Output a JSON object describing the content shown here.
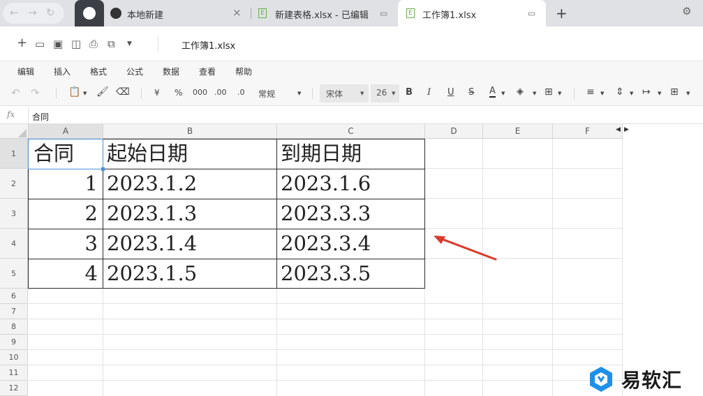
{
  "tabs": [
    {
      "label": "本地新建",
      "active": false
    },
    {
      "label": "新建表格.xlsx - 已编辑",
      "active": false
    },
    {
      "label": "工作簿1.xlsx",
      "active": true
    }
  ],
  "toolbar": {
    "doc_title": "工作簿1.xlsx"
  },
  "menu": [
    "编辑",
    "插入",
    "格式",
    "公式",
    "数据",
    "查看",
    "帮助"
  ],
  "format_toolbar": {
    "currency": "¥",
    "percent": "%",
    "thousands": "000",
    "inc_decimal": ".00",
    "dec_decimal": ".0",
    "number_format": "常规",
    "font_name": "宋体",
    "font_size": "26"
  },
  "formula_bar": {
    "fx_label": "fx",
    "value": "合同"
  },
  "columns": [
    "A",
    "B",
    "C",
    "D",
    "E",
    "F"
  ],
  "rows": [
    "1",
    "2",
    "3",
    "4",
    "5",
    "6",
    "7",
    "8",
    "9",
    "10",
    "11",
    "12"
  ],
  "table": {
    "header": [
      "合同",
      "起始日期",
      "到期日期"
    ],
    "data": [
      [
        "1",
        "2023.1.2",
        "2023.1.6"
      ],
      [
        "2",
        "2023.1.3",
        "2023.3.3"
      ],
      [
        "3",
        "2023.1.4",
        "2023.3.4"
      ],
      [
        "4",
        "2023.1.5",
        "2023.3.5"
      ]
    ]
  },
  "annotation": {
    "color": "#d93a2b"
  },
  "watermark": {
    "text": "易软汇",
    "color": "#1e90e8"
  }
}
